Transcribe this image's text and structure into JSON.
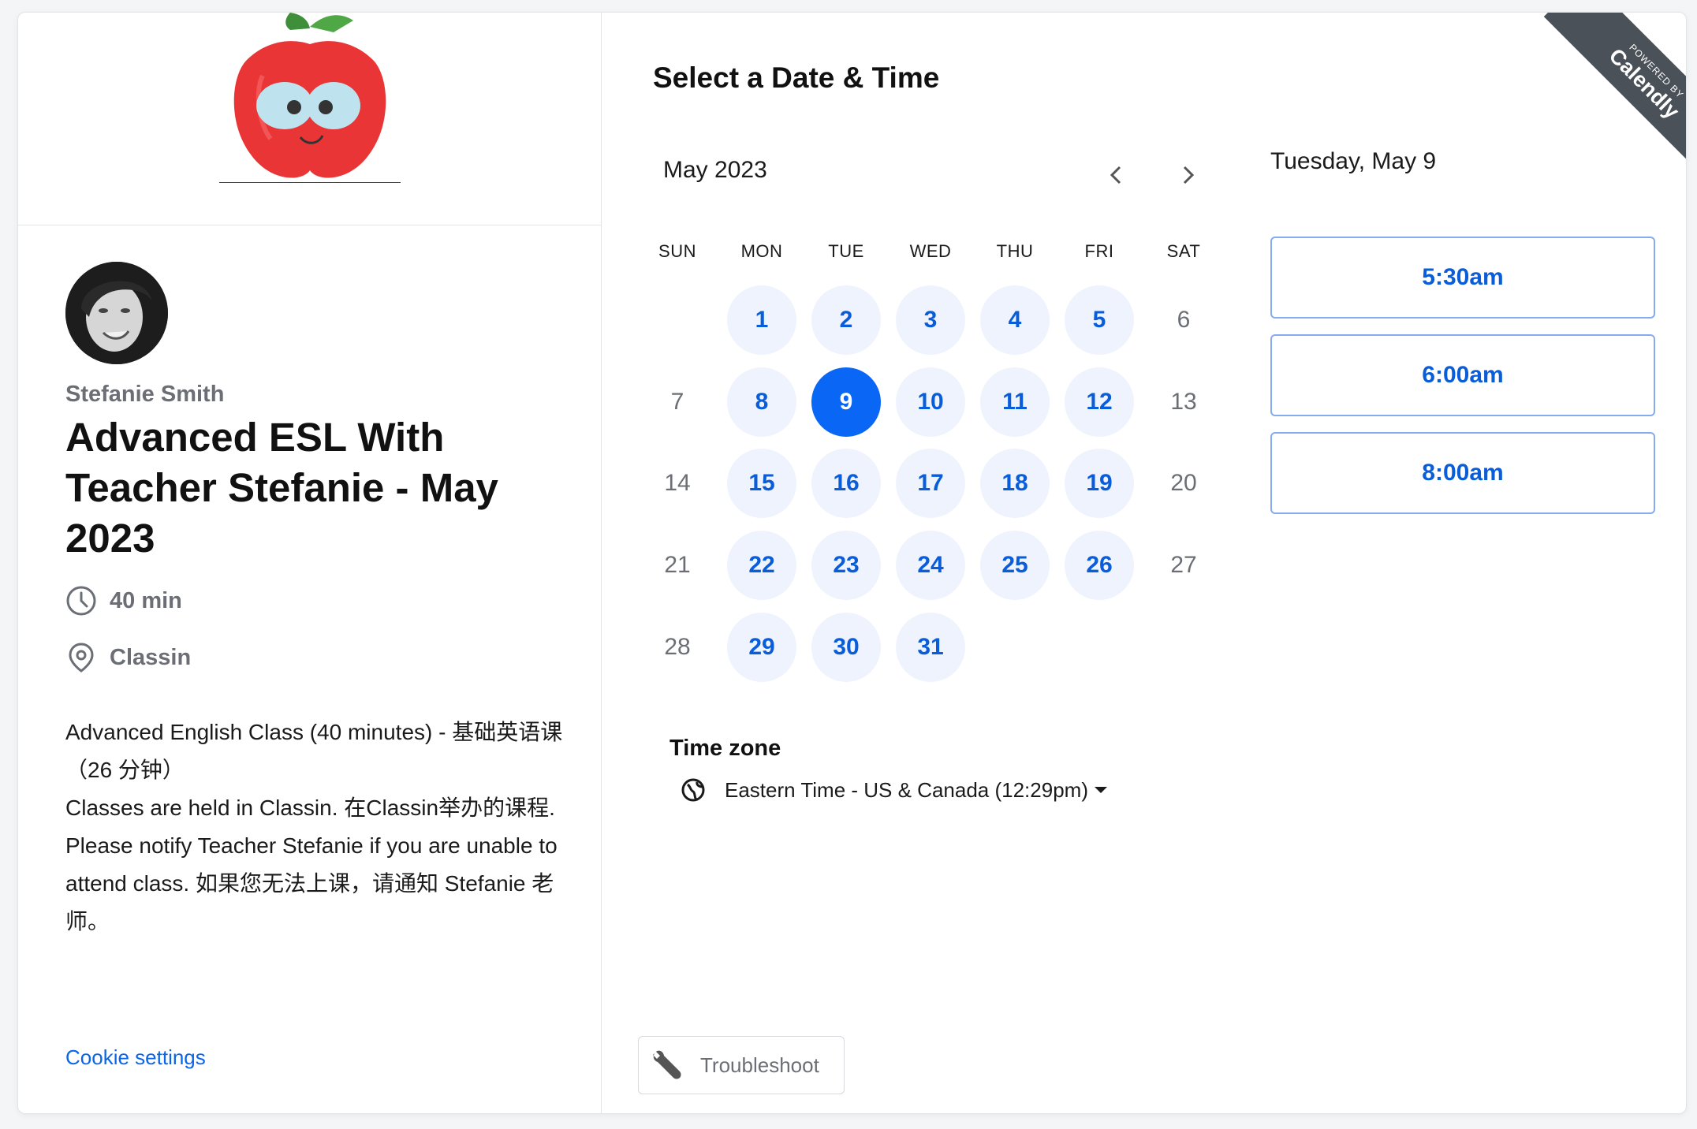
{
  "host": {
    "name": "Stefanie Smith"
  },
  "event": {
    "title": "Advanced ESL With Teacher Stefanie - May 2023",
    "duration": "40 min",
    "location": "Classin",
    "description_lines": [
      "Advanced English Class (40 minutes) - 基础英语课（26 分钟）",
      "Classes are held in Classin. 在Classin举办的课程.",
      "Please notify Teacher Stefanie if you are unable to attend class. 如果您无法上课，请通知 Stefanie 老师。"
    ]
  },
  "cookie_link": "Cookie settings",
  "scheduler": {
    "heading": "Select a Date & Time",
    "month_label": "May 2023",
    "weekdays": [
      "SUN",
      "MON",
      "TUE",
      "WED",
      "THU",
      "FRI",
      "SAT"
    ],
    "first_weekday_index": 1,
    "days_in_month": 31,
    "available_days": [
      1,
      2,
      3,
      4,
      5,
      8,
      9,
      10,
      11,
      12,
      15,
      16,
      17,
      18,
      19,
      22,
      23,
      24,
      25,
      26,
      29,
      30,
      31
    ],
    "selected_day": 9,
    "selected_date_label": "Tuesday, May 9",
    "time_slots": [
      "5:30am",
      "6:00am",
      "8:00am"
    ],
    "timezone_label": "Time zone",
    "timezone_value": "Eastern Time - US & Canada (12:29pm)"
  },
  "troubleshoot_label": "Troubleshoot",
  "ribbon": {
    "top": "POWERED BY",
    "brand": "Calendly"
  },
  "colors": {
    "accent": "#0a66f5",
    "available_bg": "#eef3fd",
    "link": "#0a66e8"
  }
}
